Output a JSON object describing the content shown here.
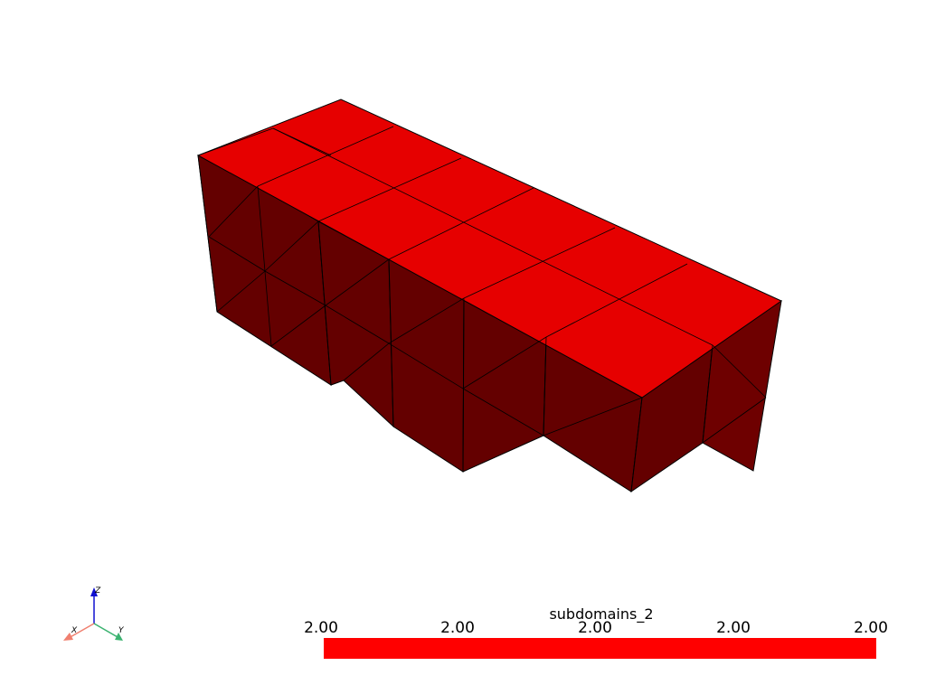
{
  "scalar_bar": {
    "title": "subdomains_2",
    "ticks": [
      "2.00",
      "2.00",
      "2.00",
      "2.00",
      "2.00"
    ],
    "color": "#ff0000"
  },
  "orientation_axes": {
    "x_label": "X",
    "y_label": "Y",
    "z_label": "Z",
    "x_color": "#f08070",
    "y_color": "#3cb371",
    "z_color": "#1010d0"
  },
  "mesh": {
    "top_color": "#e60000",
    "side_color_left": "#660000",
    "side_color_right": "#6e0000",
    "edge_color": "#000000"
  }
}
